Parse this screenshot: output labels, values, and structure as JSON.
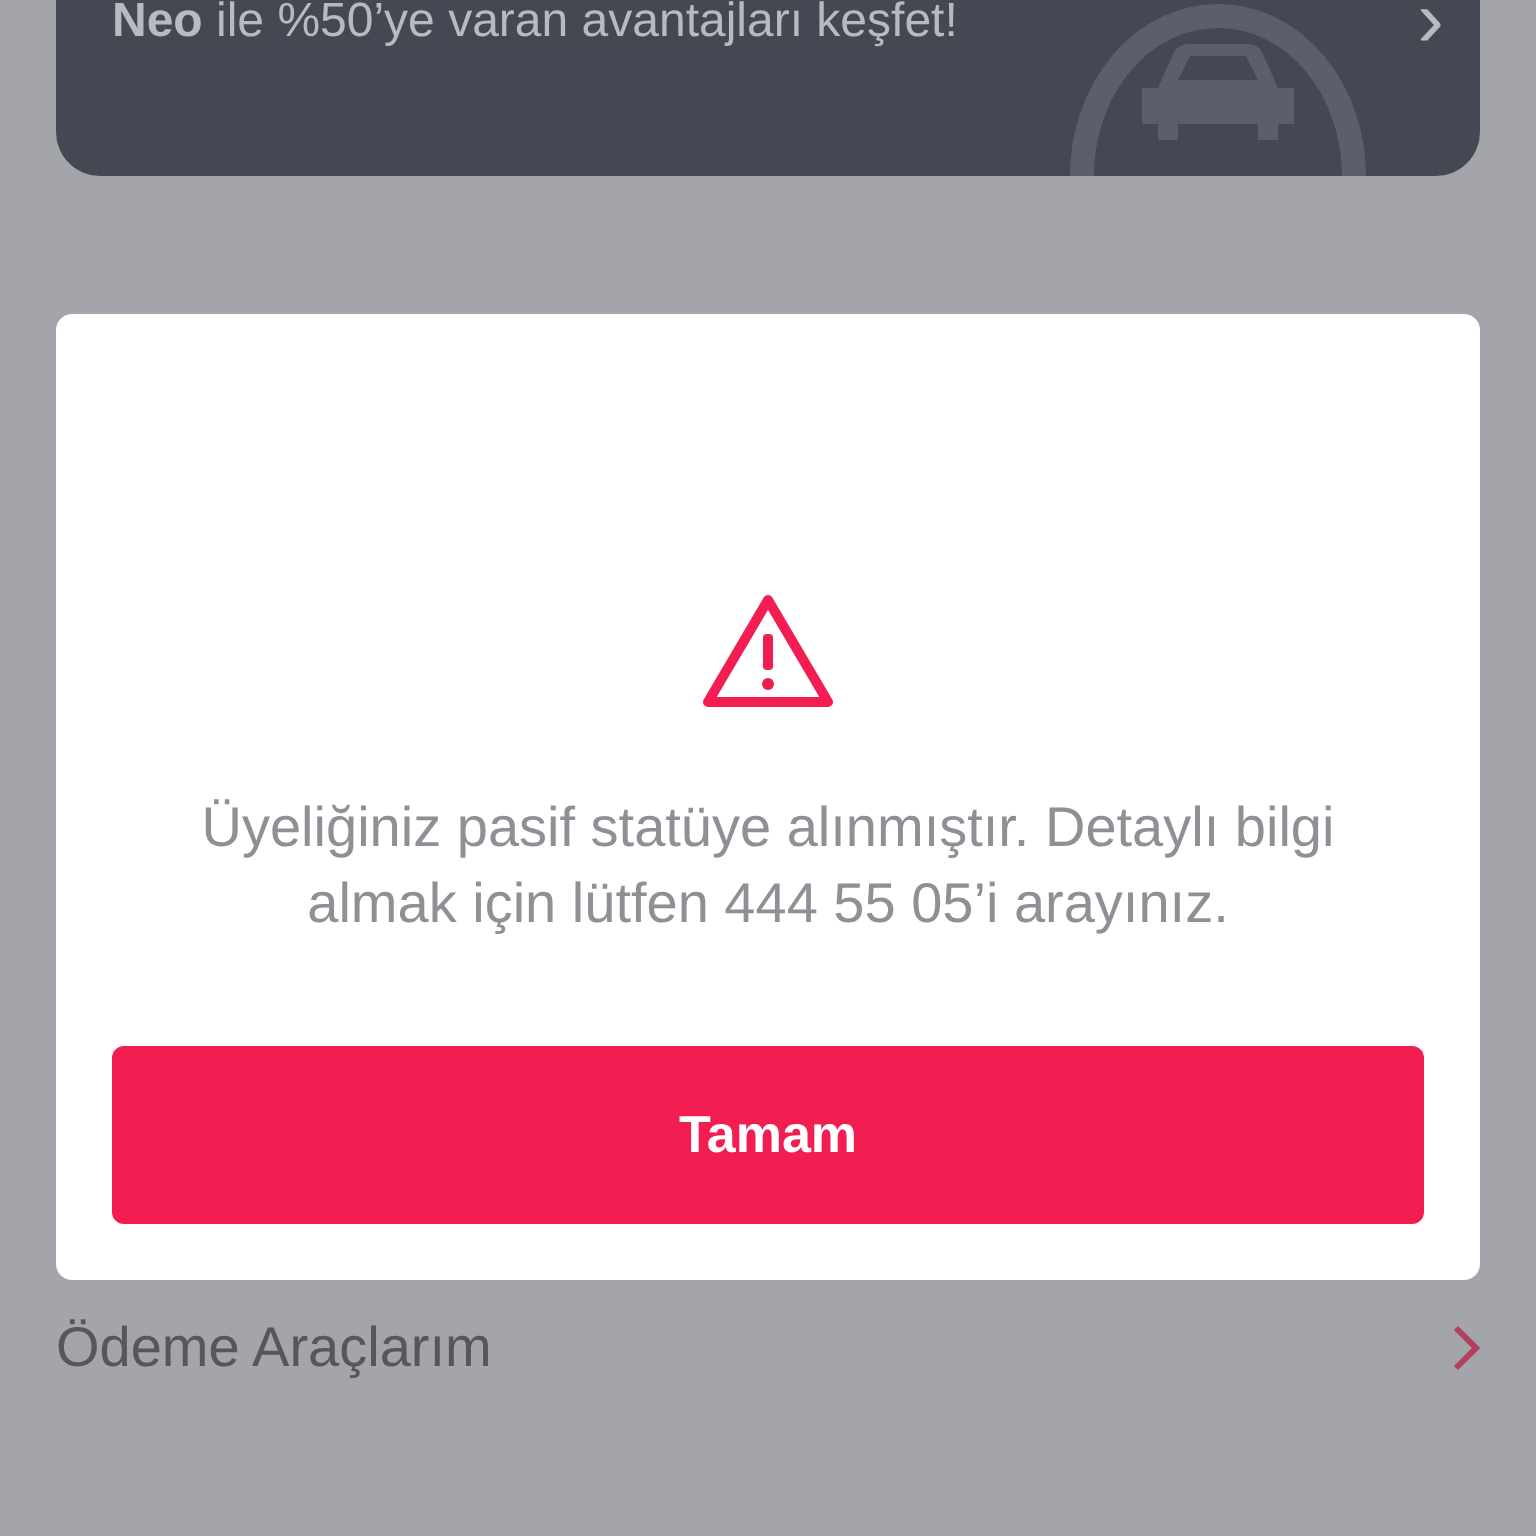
{
  "banner": {
    "text": "**Neo** ile %50’ye varan avantajları keşfet!",
    "chevron": "›"
  },
  "dialog": {
    "message": "Üyeliğiniz pasif statüye alınmıştır. Detaylı bilgi almak için lütfen 444 55 05’i arayınız.",
    "button": "Tamam"
  },
  "menu_items": [
    {
      "label": "Ödeme Araçlarım"
    }
  ]
}
